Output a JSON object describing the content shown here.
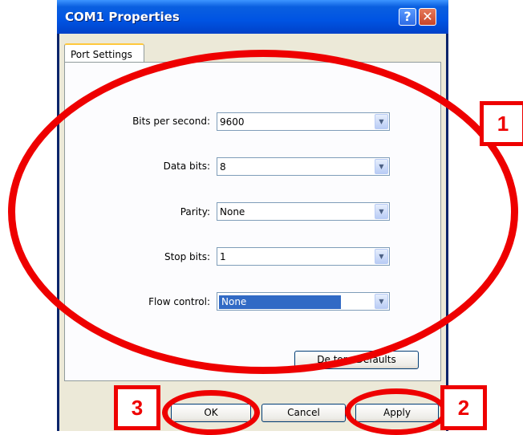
{
  "window": {
    "title": "COM1 Properties",
    "help_glyph": "?",
    "close_glyph": "✕"
  },
  "tab": {
    "label": "Port Settings"
  },
  "fields": [
    {
      "label": "Bits per second:",
      "value": "9600"
    },
    {
      "label": "Data bits:",
      "value": "8"
    },
    {
      "label": "Parity:",
      "value": "None"
    },
    {
      "label": "Stop bits:",
      "value": "1"
    },
    {
      "label": "Flow control:",
      "value": "None"
    }
  ],
  "restore_button": {
    "label": "Restore Defaults",
    "visible_label": "De  tore Defaults"
  },
  "buttons": {
    "ok": "OK",
    "cancel": "Cancel",
    "apply": "Apply"
  },
  "annotations": {
    "marker_1": "1",
    "marker_2": "2",
    "marker_3": "3",
    "color": "#EE0000"
  },
  "colors": {
    "titlebar": "#0054E3",
    "dialog_bg": "#ECE9D8",
    "selection": "#316AC5"
  }
}
